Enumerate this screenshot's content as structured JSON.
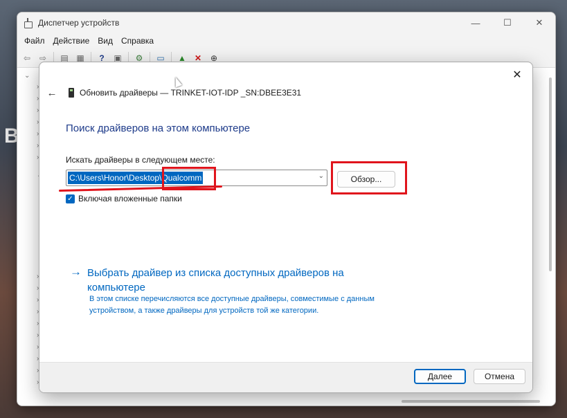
{
  "desktop": {
    "left_text": "B"
  },
  "window": {
    "title": "Диспетчер устройств",
    "controls": {
      "minimize": "—",
      "maximize": "☐",
      "close": "✕"
    },
    "menu": [
      "Файл",
      "Действие",
      "Вид",
      "Справка"
    ],
    "toolbar_icons": [
      "back-icon",
      "forward-icon",
      "properties-icon",
      "device-list-icon",
      "help-icon",
      "show-hidden-icon",
      "scan-hardware-icon",
      "monitor-icon",
      "enable-device-icon",
      "uninstall-icon",
      "update-driver-icon"
    ]
  },
  "dialog": {
    "close_glyph": "✕",
    "back_glyph": "←",
    "header_title": "Обновить драйверы — TRINKET-IOT-IDP _SN:DBEE3E31",
    "heading": "Поиск драйверов на этом компьютере",
    "search_label": "Искать драйверы в следующем месте:",
    "path_value": "C:\\Users\\Honor\\Desktop\\Qualcomm",
    "browse_label": "Обзор...",
    "include_subfolders_label": "Включая вложенные папки",
    "include_subfolders_checked": true,
    "pick_link_arrow": "→",
    "pick_link_title": "Выбрать драйвер из списка доступных драйверов на компьютере",
    "pick_link_description": "В этом списке перечисляются все доступные драйверы, совместимые с данным устройством, а также драйверы для устройств той же категории.",
    "next_label": "Далее",
    "cancel_label": "Отмена"
  },
  "colors": {
    "accent": "#0067c0",
    "heading": "#1e3b8a",
    "annotation": "#e0141c"
  }
}
